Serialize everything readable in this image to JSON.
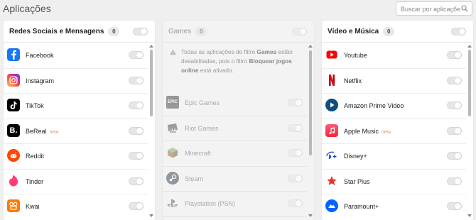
{
  "page": {
    "title": "Aplicações"
  },
  "search": {
    "placeholder": "Buscar por aplicações"
  },
  "panels": {
    "social": {
      "title": "Redes Sociais e Mensagens",
      "count": "0",
      "items": [
        {
          "name": "Facebook",
          "icon": "facebook-icon",
          "color": "#1877f2"
        },
        {
          "name": "Instagram",
          "icon": "instagram-icon",
          "color": "#d6249f"
        },
        {
          "name": "TikTok",
          "icon": "tiktok-icon",
          "color": "#000000"
        },
        {
          "name": "BeReal",
          "badge": "new",
          "icon": "bereal-icon",
          "color": "#000000"
        },
        {
          "name": "Reddit",
          "icon": "reddit-icon",
          "color": "#ff4500"
        },
        {
          "name": "Tinder",
          "icon": "tinder-icon",
          "color": "#fe3c72"
        },
        {
          "name": "Kwai",
          "icon": "kwai-icon",
          "color": "#ff7a00"
        }
      ]
    },
    "games": {
      "title": "Games",
      "count": "0",
      "notice_prefix": "Todas as aplicações do filtro ",
      "notice_filter": "Games",
      "notice_mid": " estão desabilitadas, pois o filtro ",
      "notice_block": "Bloquear jogos online",
      "notice_suffix": " está ativado.",
      "items": [
        {
          "name": "Epic Games",
          "icon": "epic-games-icon"
        },
        {
          "name": "Riot Games",
          "icon": "riot-games-icon"
        },
        {
          "name": "Minecraft",
          "icon": "minecraft-icon"
        },
        {
          "name": "Steam",
          "icon": "steam-icon"
        },
        {
          "name": "Playstation (PSN)",
          "icon": "playstation-icon"
        }
      ]
    },
    "video": {
      "title": "Vídeo e Música",
      "count": "0",
      "items": [
        {
          "name": "Youtube",
          "icon": "youtube-icon",
          "color": "#ff0000"
        },
        {
          "name": "Netflix",
          "icon": "netflix-icon",
          "color": "#e50914"
        },
        {
          "name": "Amazon Prime Video",
          "icon": "prime-video-icon",
          "color": "#1a98ff"
        },
        {
          "name": "Apple Music",
          "badge": "new",
          "icon": "apple-music-icon",
          "color": "#fa2d48"
        },
        {
          "name": "Disney+",
          "icon": "disney-plus-icon",
          "color": "#113ccf"
        },
        {
          "name": "Star Plus",
          "icon": "star-plus-icon",
          "color": "#e8352d"
        },
        {
          "name": "Paramount+",
          "icon": "paramount-plus-icon",
          "color": "#0064ff"
        }
      ]
    }
  }
}
